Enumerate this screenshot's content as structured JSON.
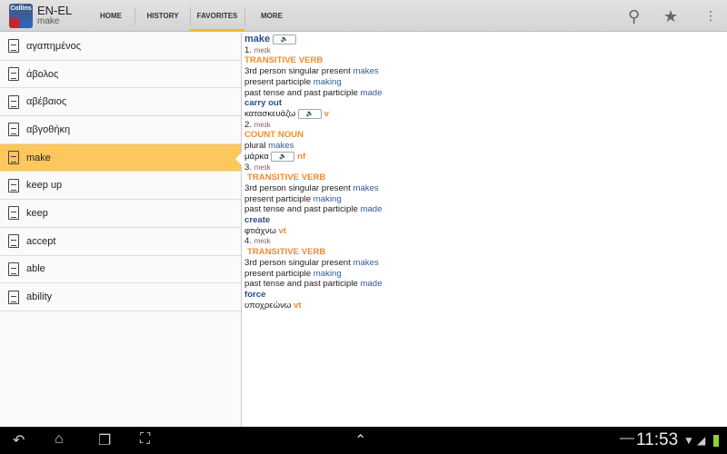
{
  "header": {
    "logo": "Collins",
    "title": "EN-EL",
    "subtitle": "make",
    "tabs": [
      "HOME",
      "HISTORY",
      "FAVORITES",
      "MORE"
    ],
    "active_tab": "FAVORITES",
    "icons": [
      "search-icon",
      "star-icon",
      "overflow-menu-icon"
    ]
  },
  "list": [
    "αγαπημένος",
    "άβολος",
    "αβέβαιος",
    "αβγοθήκη",
    "make",
    "keep up",
    "keep",
    "accept",
    "able",
    "ability"
  ],
  "selected": "make",
  "entry": {
    "headword": "make",
    "senses": [
      {
        "num": "1.",
        "pron": "meɪk",
        "pos": "TRANSITIVE VERB",
        "forms": [
          [
            "3rd person singular present",
            "makes"
          ],
          [
            "present participle",
            "making"
          ],
          [
            "past tense and past participle",
            "made"
          ]
        ],
        "meaning": "carry out",
        "translation": "κατασκευάζω",
        "tr_pos": "v",
        "audio": true
      },
      {
        "num": "2.",
        "pron": "meɪk",
        "pos": "COUNT NOUN",
        "forms": [
          [
            "plural",
            "makes"
          ]
        ],
        "meaning": "",
        "translation": "μάρκα",
        "tr_pos": "nf",
        "audio": true
      },
      {
        "num": "3.",
        "pron": "meɪk",
        "pos": "TRANSITIVE VERB",
        "forms": [
          [
            "3rd person singular present",
            "makes"
          ],
          [
            "present participle",
            "making"
          ],
          [
            "past tense and past participle",
            "made"
          ]
        ],
        "meaning": "create",
        "translation": "φτιάχνω",
        "tr_pos": "vt",
        "audio": false
      },
      {
        "num": "4.",
        "pron": "meɪk",
        "pos": "TRANSITIVE VERB",
        "forms": [
          [
            "3rd person singular present",
            "makes"
          ],
          [
            "present participle",
            "making"
          ],
          [
            "past tense and past participle",
            "made"
          ]
        ],
        "meaning": "force",
        "translation": "υποχρεώνω",
        "tr_pos": "vt",
        "audio": false
      }
    ]
  },
  "status": {
    "time": "11:53"
  },
  "colors": {
    "accent": "#f5b731",
    "selected": "#fcc75c",
    "pos": "#f28a2d",
    "link": "#2f5a9c"
  }
}
